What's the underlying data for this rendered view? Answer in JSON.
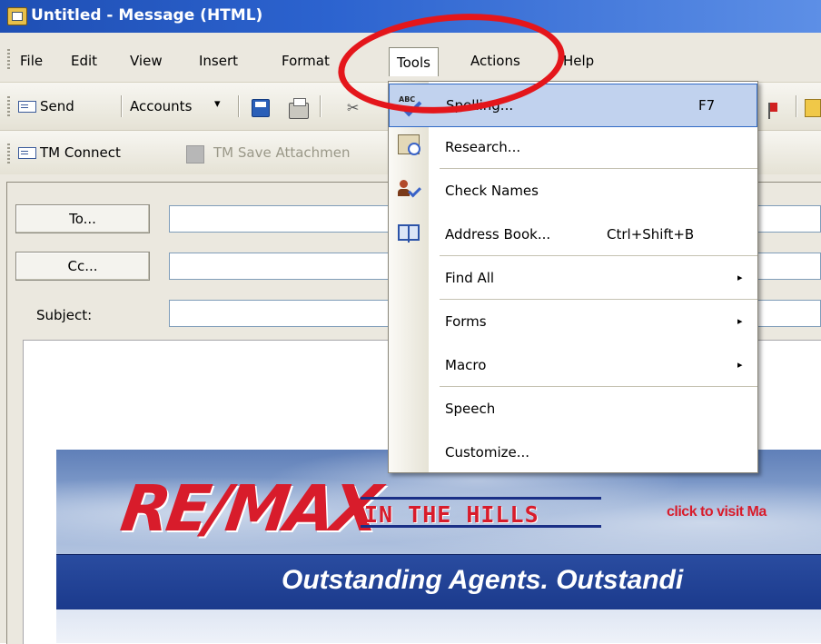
{
  "window": {
    "title": "Untitled - Message (HTML)"
  },
  "menubar": {
    "items": [
      "File",
      "Edit",
      "View",
      "Insert",
      "Format",
      "Tools",
      "Actions",
      "Help"
    ],
    "active": "Tools"
  },
  "toolbar1": {
    "send": "Send",
    "accounts": "Accounts",
    "dropdown": "▾"
  },
  "toolbar2": {
    "tm_connect": "TM Connect",
    "tm_save": "TM Save Attachmen"
  },
  "form": {
    "to_label": "To...",
    "cc_label": "Cc...",
    "subject_label": "Subject:"
  },
  "tools_menu": {
    "items": [
      {
        "label": "Spelling...",
        "shortcut": "F7",
        "selected": true,
        "icon": "spelling-icon"
      },
      {
        "label": "Research...",
        "shortcut": "",
        "icon": "research-icon"
      },
      {
        "label": "Check Names",
        "shortcut": "",
        "icon": "check-names-icon"
      },
      {
        "label": "Address Book...",
        "shortcut": "Ctrl+Shift+B",
        "icon": "address-book-icon"
      },
      {
        "label": "Find All",
        "submenu": "▸"
      },
      {
        "label": "Forms",
        "submenu": "▸"
      },
      {
        "label": "Macro",
        "submenu": "▸"
      },
      {
        "label": "Speech"
      },
      {
        "label": "Customize..."
      }
    ]
  },
  "banner": {
    "logo": "RE/MAX",
    "logo_sub": "IN THE HILLS",
    "link": "click to visit Ma",
    "tagline": "Outstanding Agents.  Outstandi"
  },
  "colors": {
    "accent_red": "#e4161b",
    "titlebar": "#2c63cf",
    "menu_highlight": "#c1d2ee"
  }
}
